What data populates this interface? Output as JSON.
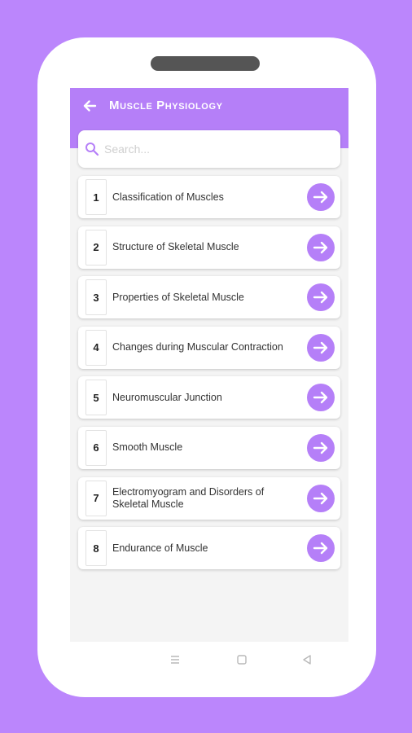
{
  "app": {
    "title": "Muscle Physiology",
    "accent_color": "#b57ff8",
    "background_color": "#bb86fc"
  },
  "header": {
    "back_icon": "arrow-left-icon"
  },
  "search": {
    "placeholder": "Search...",
    "icon": "search-icon"
  },
  "chapters": [
    {
      "number": "1",
      "title": "Classification of Muscles"
    },
    {
      "number": "2",
      "title": "Structure of Skeletal Muscle"
    },
    {
      "number": "3",
      "title": "Properties of Skeletal Muscle"
    },
    {
      "number": "4",
      "title": "Changes during Muscular Contraction"
    },
    {
      "number": "5",
      "title": "Neuromuscular Junction"
    },
    {
      "number": "6",
      "title": "Smooth Muscle"
    },
    {
      "number": "7",
      "title": "Electromyogram and Disorders of Skeletal Muscle"
    },
    {
      "number": "8",
      "title": "Endurance of Muscle"
    }
  ],
  "navbar": {
    "icons": [
      "menu-icon",
      "home-square-icon",
      "back-triangle-icon"
    ]
  }
}
